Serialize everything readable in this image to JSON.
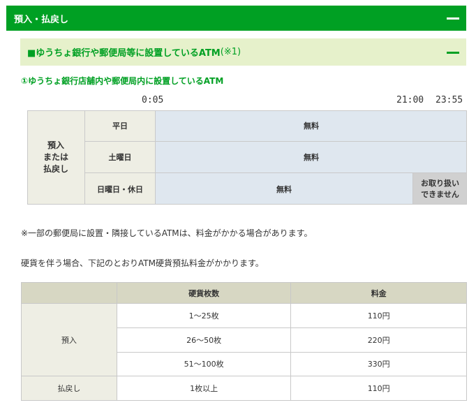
{
  "header": {
    "title": "預入・払戻し"
  },
  "section": {
    "title": "■ゆうちょ銀行や郵便局等に設置しているATM",
    "note": "(※1)"
  },
  "subsection": {
    "title": "①ゆうちょ銀行店舗内や郵便局内に設置しているATM"
  },
  "timeline": {
    "start": "0:05",
    "mid": "21:00",
    "end": "23:55"
  },
  "fee_table": {
    "row_header": [
      "預入",
      "または",
      "払戻し"
    ],
    "rows": [
      {
        "day": "平日",
        "fee": "無料"
      },
      {
        "day": "土曜日",
        "fee": "無料"
      },
      {
        "day": "日曜日・休日",
        "fee": "無料",
        "after": [
          "お取り扱い",
          "できません"
        ]
      }
    ]
  },
  "notes": [
    "※一部の郵便局に設置・隣接しているATMは、料金がかかる場合があります。",
    "硬貨を伴う場合、下記のとおりATM硬貨預払料金がかかります。"
  ],
  "coin_table": {
    "headers": [
      "",
      "硬貨枚数",
      "料金"
    ],
    "deposit_label": "預入",
    "deposit_rows": [
      {
        "count": "1～25枚",
        "fee": "110円"
      },
      {
        "count": "26～50枚",
        "fee": "220円"
      },
      {
        "count": "51～100枚",
        "fee": "330円"
      }
    ],
    "withdraw_label": "払戻し",
    "withdraw_row": {
      "count": "1枚以上",
      "fee": "110円"
    }
  },
  "colors": {
    "green": "#00a023",
    "light_green": "#e6f1cb",
    "row_header_bg": "#eeeee4",
    "free_bg": "#dfe7ef",
    "unavailable_bg": "#d0d0d0",
    "table_head_bg": "#d7d7c3"
  }
}
